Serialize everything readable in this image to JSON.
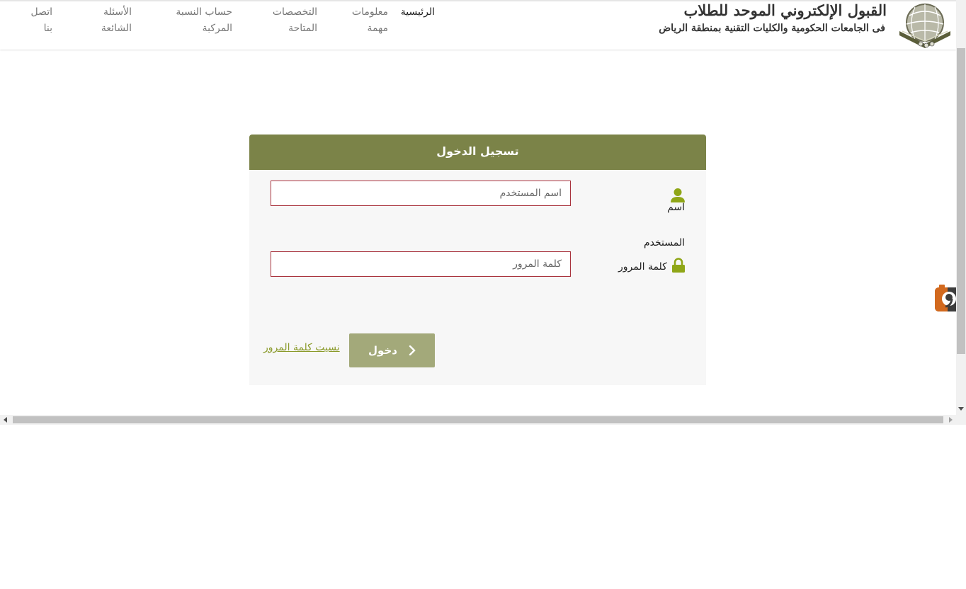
{
  "header": {
    "site_title": "القبول الإلكتروني الموحد للطلاب",
    "site_subtitle": "فى الجامعات الحكومية والكليات التقنية بمنطقة الرياض",
    "nav": [
      {
        "label": "الرئيسية",
        "active": true
      },
      {
        "label": "معلومات مهمة"
      },
      {
        "label": "التخصصات المتاحة"
      },
      {
        "label": "حساب النسبة المركبة"
      },
      {
        "label": "الأسئلة الشائعة"
      },
      {
        "label": "اتصل بنا"
      }
    ]
  },
  "login": {
    "title": "تسجيل الدخول",
    "username_label": "اسم المستخدم",
    "username_placeholder": "اسم المستخدم",
    "password_label": "كلمة المرور",
    "password_placeholder": "كلمة المرور",
    "submit_label": "دخول",
    "forgot_label": "نسيت كلمة المرور"
  },
  "colors": {
    "card_header": "#7b8348",
    "button": "#a3a97a",
    "icon": "#8fa617",
    "input_border": "#a8323c",
    "link": "#8a9a2a"
  },
  "icons": {
    "username": "user-icon",
    "password": "lock-icon",
    "submit": "chevron-right-icon",
    "widget": "camera-icon"
  }
}
